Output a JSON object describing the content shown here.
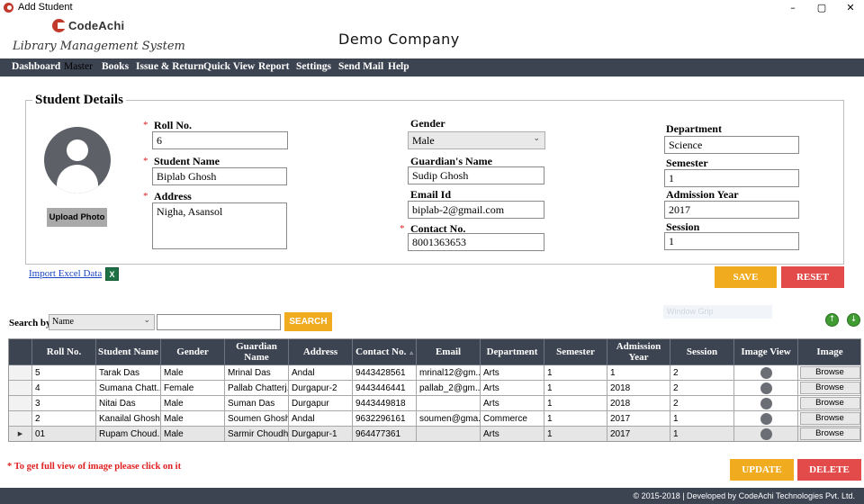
{
  "window": {
    "title": "Add Student",
    "buttons": [
      "–",
      "▢",
      "✕"
    ]
  },
  "header": {
    "brand": "CodeAchi",
    "subtitle": "Library Management System",
    "company": "Demo Company"
  },
  "menu": {
    "items": [
      "Dashboard",
      "Master",
      "Books",
      "Issue & Return",
      "Quick View",
      "Report",
      "Settings",
      "Send Mail",
      "Help"
    ],
    "active": "Master"
  },
  "form": {
    "legend": "Student Details",
    "upload_label": "Upload Photo",
    "roll_label": "Roll No.",
    "roll_value": "6",
    "name_label": "Student Name",
    "name_value": "Biplab Ghosh",
    "address_label": "Address",
    "address_value": "Nigha, Asansol",
    "gender_label": "Gender",
    "gender_value": "Male",
    "guardian_label": "Guardian's Name",
    "guardian_value": "Sudip Ghosh",
    "email_label": "Email Id",
    "email_value": "biplab-2@gmail.com",
    "contact_label": "Contact No.",
    "contact_value": "8001363653",
    "department_label": "Department",
    "department_value": "Science",
    "semester_label": "Semester",
    "semester_value": "1",
    "admission_label": "Admission Year",
    "admission_value": "2017",
    "session_label": "Session",
    "session_value": "1",
    "required_mark": "*"
  },
  "import": {
    "label": "Import Excel Data",
    "icon": "excel-icon",
    "icon_text": "X"
  },
  "actions": {
    "save": "SAVE",
    "reset": "RESET",
    "update": "UPDATE",
    "delete": "DELETE"
  },
  "search": {
    "label": "Search by",
    "by_value": "Name",
    "query": "",
    "button": "SEARCH"
  },
  "watermark": "Window Grip",
  "nav_arrows": [
    "↑",
    "↓"
  ],
  "table": {
    "columns": [
      "Roll No.",
      "Student Name",
      "Gender",
      "Guardian Name",
      "Address",
      "Contact No.",
      "Email",
      "Department",
      "Semester",
      "Admission Year",
      "Session",
      "Image View",
      "Image"
    ],
    "sorted_column": "Contact No.",
    "sort_glyph": "▵",
    "rows": [
      [
        "5",
        "Tarak Das",
        "Male",
        "Mrinal Das",
        "Andal",
        "9443428561",
        "mrinal12@gm...",
        "Arts",
        "1",
        "1",
        "2",
        "",
        "Browse"
      ],
      [
        "4",
        "Sumana Chatt...",
        "Female",
        "Pallab Chatterj...",
        "Durgapur-2",
        "9443446441",
        "pallab_2@gm...",
        "Arts",
        "1",
        "2018",
        "2",
        "",
        "Browse"
      ],
      [
        "3",
        "Nitai Das",
        "Male",
        "Suman Das",
        "Durgapur",
        "9443449818",
        "",
        "Arts",
        "1",
        "2018",
        "2",
        "",
        "Browse"
      ],
      [
        "2",
        "Kanailal Ghosh",
        "Male",
        "Soumen Ghosh",
        "Andal",
        "9632296161",
        "soumen@gma...",
        "Commerce",
        "1",
        "2017",
        "1",
        "",
        "Browse"
      ],
      [
        "01",
        "Rupam Choud...",
        "Male",
        "Sarmir Choudh...",
        "Durgapur-1",
        "964477361",
        "",
        "Arts",
        "1",
        "2017",
        "1",
        "",
        "Browse"
      ]
    ],
    "selected_row": 4,
    "row_pointer": "▶"
  },
  "note": "* To get full view of image please click on it",
  "footer": "© 2015-2018 | Developed by CodeAchi Technologies Pvt. Ltd.",
  "colors": {
    "dark_bar": "#3d4451",
    "accent_orange": "#f0ab1f",
    "accent_red": "#e34b4b",
    "brand_red": "#c0392b",
    "required_red": "#e02020"
  }
}
